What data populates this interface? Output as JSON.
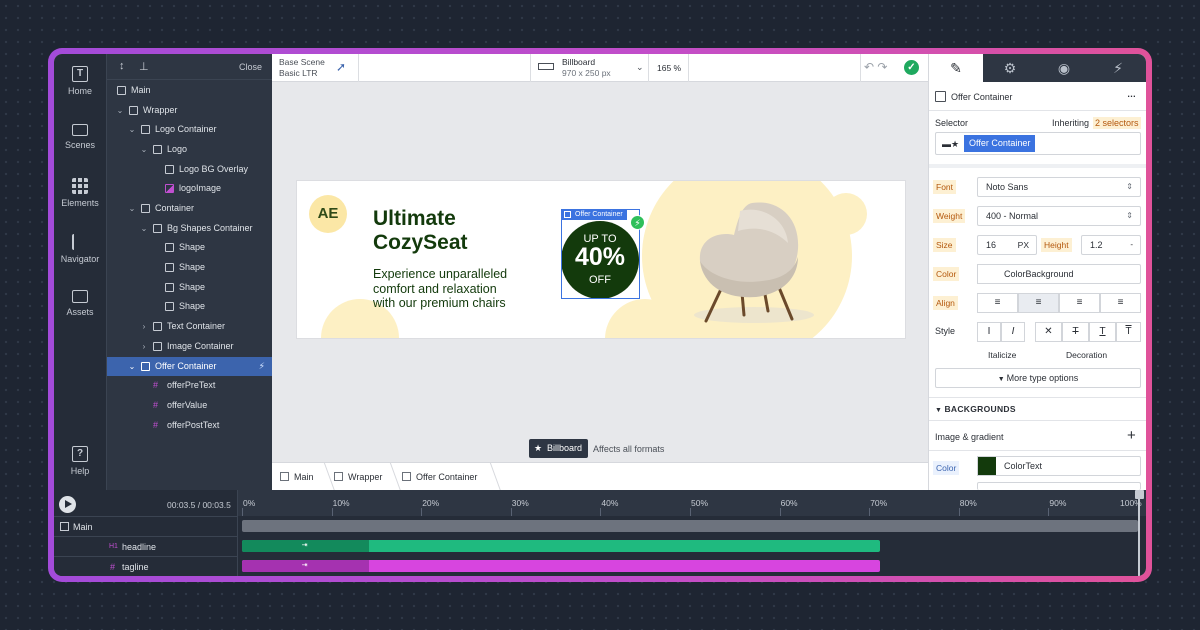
{
  "rail": {
    "items": [
      {
        "label": "Home",
        "icon": "T"
      },
      {
        "label": "Scenes",
        "icon": ""
      },
      {
        "label": "Elements",
        "icon": ""
      },
      {
        "label": "Navigator",
        "icon": ""
      },
      {
        "label": "Assets",
        "icon": ""
      },
      {
        "label": "Help",
        "icon": "?"
      }
    ]
  },
  "layers": {
    "close_label": "Close",
    "items": [
      {
        "label": "Main"
      },
      {
        "label": "Wrapper"
      },
      {
        "label": "Logo Container"
      },
      {
        "label": "Logo"
      },
      {
        "label": "Logo BG Overlay"
      },
      {
        "label": "logoImage"
      },
      {
        "label": "Container"
      },
      {
        "label": "Bg Shapes Container"
      },
      {
        "label": "Shape"
      },
      {
        "label": "Shape"
      },
      {
        "label": "Shape"
      },
      {
        "label": "Shape"
      },
      {
        "label": "Text Container"
      },
      {
        "label": "Image Container"
      },
      {
        "label": "Offer Container"
      },
      {
        "label": "offerPreText"
      },
      {
        "label": "offerValue"
      },
      {
        "label": "offerPostText"
      }
    ]
  },
  "topbar": {
    "scene_title": "Base Scene",
    "scene_sub": "Basic LTR",
    "format_name": "Billboard",
    "format_size": "970 x 250 px",
    "zoom": "165 %"
  },
  "banner": {
    "logo_text": "AE",
    "headline_line1": "Ultimate",
    "headline_line2": "CozySeat",
    "tagline_line1": "Experience unparalleled",
    "tagline_line2": "comfort and relaxation",
    "tagline_line3": "with our premium chairs",
    "offer_tag": "Offer Container",
    "offer_pre": "UP TO",
    "offer_value": "40%",
    "offer_post": "OFF",
    "colors": {
      "dark_green": "#133a0c",
      "cream": "#fdf0c4"
    }
  },
  "canvas_footer": {
    "format_chip": "Billboard",
    "note": "Affects all formats",
    "breadcrumbs": [
      "Main",
      "Wrapper",
      "Offer Container"
    ]
  },
  "props": {
    "element_name": "Offer Container",
    "more": "…",
    "selector_label": "Selector",
    "inheriting_label": "Inheriting",
    "inheriting_count": "2 selectors",
    "selector_chip": "Offer Container",
    "font_label": "Font",
    "font_value": "Noto Sans",
    "weight_label": "Weight",
    "weight_value": "400 - Normal",
    "size_label": "Size",
    "size_value": "16",
    "size_unit": "PX",
    "height_label": "Height",
    "height_value": "1.2",
    "height_unit": "-",
    "color_label": "Color",
    "color_value": "ColorBackground",
    "align_label": "Align",
    "style_label": "Style",
    "italicize_label": "Italicize",
    "decoration_label": "Decoration",
    "more_type": "More type options",
    "backgrounds_label": "BACKGROUNDS",
    "image_gradient_label": "Image & gradient",
    "bg_color_label": "Color",
    "bg_color_value": "ColorText",
    "bg_swatch": "#133a0c"
  },
  "timeline": {
    "time": "00:03.5 / 00:03.5",
    "ticks": [
      "0%",
      "10%",
      "20%",
      "30%",
      "40%",
      "50%",
      "60%",
      "70%",
      "80%",
      "90%",
      "100%"
    ],
    "rows": [
      {
        "label": "Main",
        "prefix": ""
      },
      {
        "label": "headline",
        "prefix": "H1"
      },
      {
        "label": "tagline",
        "prefix": "#"
      }
    ],
    "tracks": [
      {
        "start": 0,
        "end": 100,
        "delay_end": 0,
        "color": "#6d737e",
        "delay_color": "#6d737e"
      },
      {
        "start": 0,
        "end": 71.2,
        "delay_end": 14.2,
        "color": "#1fba7f",
        "delay_color": "#138a5c"
      },
      {
        "start": 0,
        "end": 71.2,
        "delay_end": 14.2,
        "color": "#d745df",
        "delay_color": "#a532b0"
      }
    ]
  }
}
